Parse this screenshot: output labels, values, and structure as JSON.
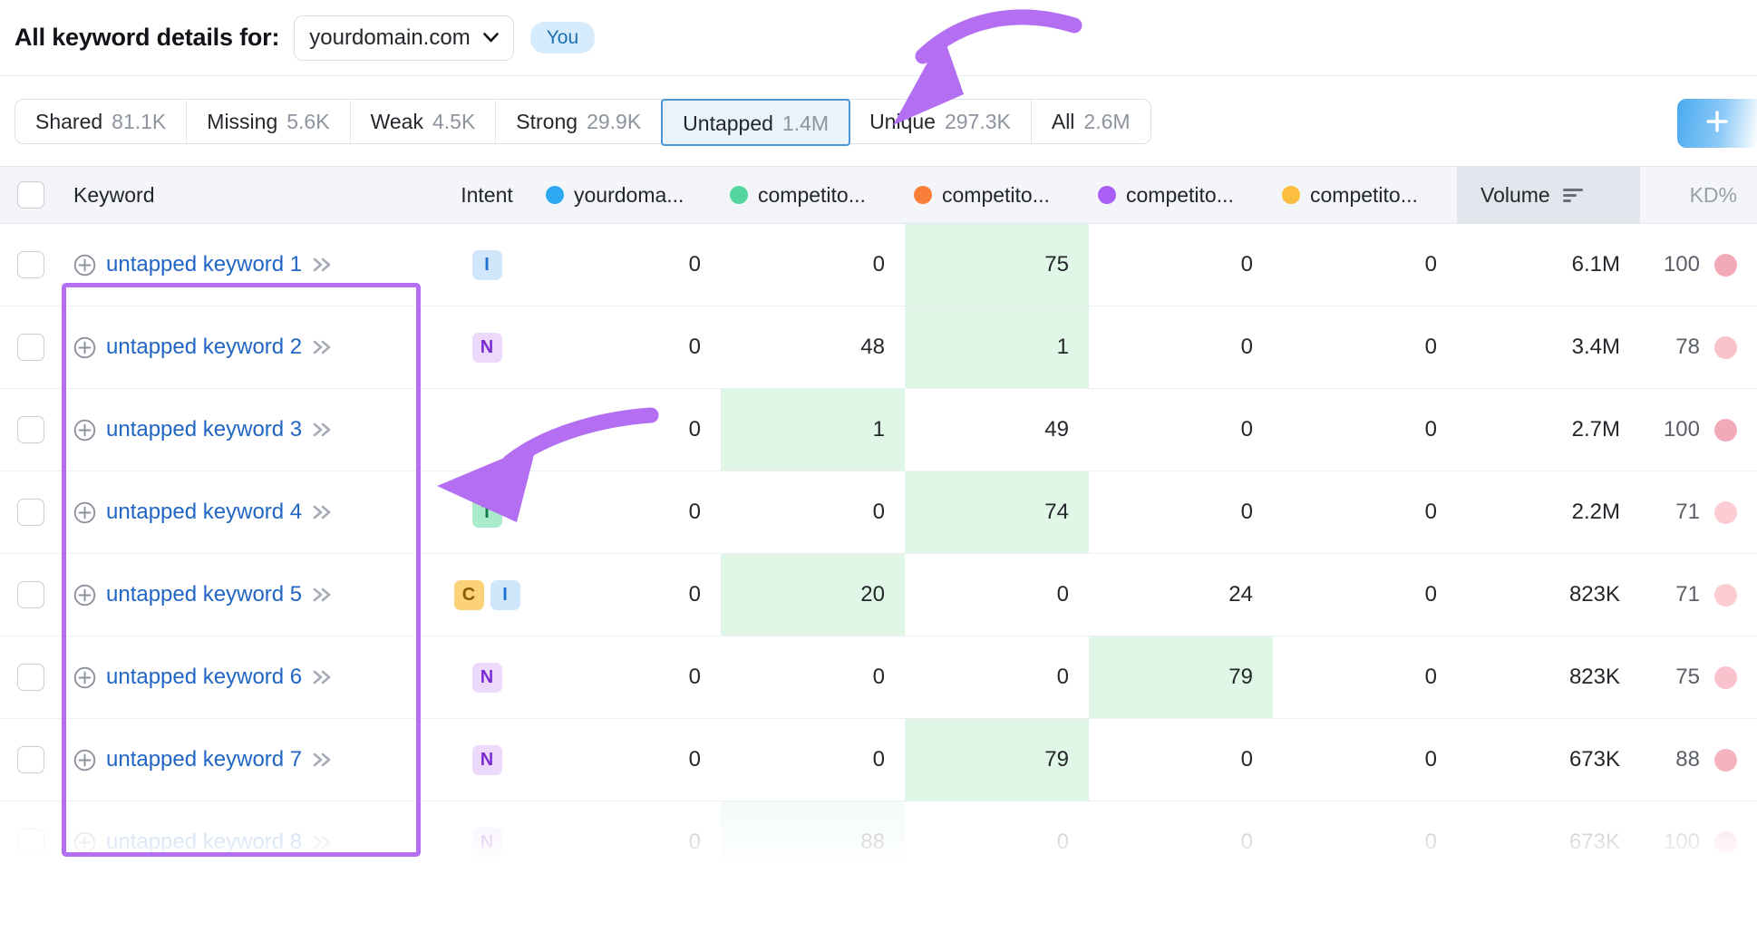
{
  "header": {
    "title": "All keyword details for:",
    "domain_value": "yourdomain.com",
    "you_label": "You",
    "chevron_icon": "chevron-down-icon"
  },
  "tabs": {
    "add_button_icon": "plus-icon",
    "items": [
      {
        "label": "Shared",
        "count": "81.1K",
        "selected": false
      },
      {
        "label": "Missing",
        "count": "5.6K",
        "selected": false
      },
      {
        "label": "Weak",
        "count": "4.5K",
        "selected": false
      },
      {
        "label": "Strong",
        "count": "29.9K",
        "selected": false
      },
      {
        "label": "Untapped",
        "count": "1.4M",
        "selected": true
      },
      {
        "label": "Unique",
        "count": "297.3K",
        "selected": false
      },
      {
        "label": "All",
        "count": "2.6M",
        "selected": false
      }
    ]
  },
  "table": {
    "columns": {
      "keyword": "Keyword",
      "intent": "Intent",
      "volume": "Volume",
      "kd": "KD%",
      "sort_icon": "sort-descending-icon",
      "sites": [
        {
          "label": "yourdoma...",
          "color": "#2fa8f2"
        },
        {
          "label": "competito...",
          "color": "#55d6a1"
        },
        {
          "label": "competito...",
          "color": "#f97f39"
        },
        {
          "label": "competito...",
          "color": "#a95ef5"
        },
        {
          "label": "competito...",
          "color": "#fbbe3d"
        }
      ]
    },
    "rows": [
      {
        "keyword": "untapped keyword 1",
        "intent": [
          "I"
        ],
        "values": [
          "0",
          "0",
          "75",
          "0",
          "0"
        ],
        "highlight": 2,
        "volume": "6.1M",
        "kd": "100",
        "kd_color": "#f3aab8",
        "faded": false
      },
      {
        "keyword": "untapped keyword 2",
        "intent": [
          "N"
        ],
        "values": [
          "0",
          "48",
          "1",
          "0",
          "0"
        ],
        "highlight": 2,
        "volume": "3.4M",
        "kd": "78",
        "kd_color": "#fac2cc",
        "faded": false
      },
      {
        "keyword": "untapped keyword 3",
        "intent": [],
        "values": [
          "0",
          "1",
          "49",
          "0",
          "0"
        ],
        "highlight": 1,
        "volume": "2.7M",
        "kd": "100",
        "kd_color": "#f3aab8",
        "faded": false
      },
      {
        "keyword": "untapped keyword 4",
        "intent": [
          "T"
        ],
        "values": [
          "0",
          "0",
          "74",
          "0",
          "0"
        ],
        "highlight": 2,
        "volume": "2.2M",
        "kd": "71",
        "kd_color": "#fbccd4",
        "faded": false
      },
      {
        "keyword": "untapped keyword 5",
        "intent": [
          "C",
          "I"
        ],
        "values": [
          "0",
          "20",
          "0",
          "24",
          "0"
        ],
        "highlight": 1,
        "volume": "823K",
        "kd": "71",
        "kd_color": "#fbccd4",
        "faded": false
      },
      {
        "keyword": "untapped keyword 6",
        "intent": [
          "N"
        ],
        "values": [
          "0",
          "0",
          "0",
          "79",
          "0"
        ],
        "highlight": 3,
        "volume": "823K",
        "kd": "75",
        "kd_color": "#fac2cc",
        "faded": false
      },
      {
        "keyword": "untapped keyword 7",
        "intent": [
          "N"
        ],
        "values": [
          "0",
          "0",
          "79",
          "0",
          "0"
        ],
        "highlight": 2,
        "volume": "673K",
        "kd": "88",
        "kd_color": "#f5b3c0",
        "faded": false
      },
      {
        "keyword": "untapped keyword 8",
        "intent": [
          "N"
        ],
        "values": [
          "0",
          "88",
          "0",
          "0",
          "0"
        ],
        "highlight": 1,
        "volume": "673K",
        "kd": "100",
        "kd_color": "#f3aab8",
        "faded": true
      }
    ],
    "row_icons": {
      "add_keyword_icon": "plus-circle-icon",
      "expand_icon": "double-chevron-right-icon",
      "checkbox_icon": "checkbox-icon"
    }
  },
  "annotations": {
    "highlight_color": "#b36ef2",
    "box_target": "keyword-column",
    "arrow_top_target": "untapped-tab",
    "arrow_left_target": "keyword-rows"
  }
}
